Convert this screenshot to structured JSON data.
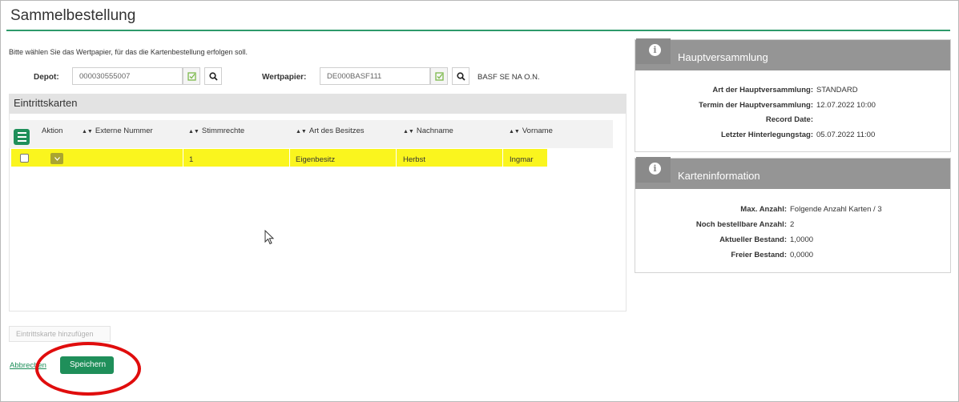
{
  "page": {
    "title": "Sammelbestellung",
    "intro": "Bitte wählen Sie das Wertpapier, für das die Kartenbestellung erfolgen soll."
  },
  "depot": {
    "label": "Depot:",
    "value": "000030555007"
  },
  "wertpapier": {
    "label": "Wertpapier:",
    "value": "DE000BASF111",
    "name": "BASF SE NA O.N."
  },
  "section": {
    "title": "Eintrittskarten"
  },
  "table": {
    "columns": [
      "Aktion",
      "Externe Nummer",
      "Stimmrechte",
      "Art des Besitzes",
      "Nachname",
      "Vorname"
    ],
    "rows": [
      {
        "externe_nummer": "",
        "stimmrechte": "1",
        "art_des_besitzes": "Eigenbesitz",
        "nachname": "Herbst",
        "vorname": "Ingmar"
      }
    ]
  },
  "buttons": {
    "add_card": "Eintrittskarte hinzufügen",
    "cancel": "Abbrechen",
    "save": "Speichern"
  },
  "hauptversammlung": {
    "title": "Hauptversammlung",
    "items": [
      {
        "label": "Art der Hauptversammlung:",
        "value": "STANDARD"
      },
      {
        "label": "Termin der Hauptversammlung:",
        "value": "12.07.2022 10:00"
      },
      {
        "label": "Record Date:",
        "value": ""
      },
      {
        "label": "Letzter Hinterlegungstag:",
        "value": "05.07.2022 11:00"
      }
    ]
  },
  "karteninformation": {
    "title": "Karteninformation",
    "items": [
      {
        "label": "Max. Anzahl:",
        "value": "Folgende Anzahl Karten / 3"
      },
      {
        "label": "Noch bestellbare Anzahl:",
        "value": "2"
      },
      {
        "label": "Aktueller Bestand:",
        "value": "1,0000"
      },
      {
        "label": "Freier Bestand:",
        "value": "0,0000"
      }
    ]
  },
  "colors": {
    "accent": "#1f8f5a",
    "highlight": "#faf51e",
    "annotation": "#e00d0d",
    "panel_header": "#959595"
  }
}
